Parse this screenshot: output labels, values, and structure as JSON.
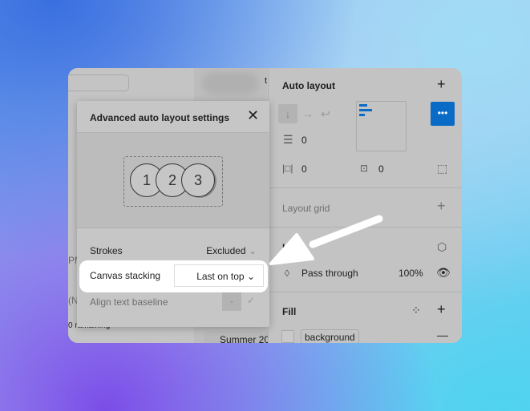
{
  "left_panel": {
    "fragments": [
      "PM",
      "(N",
      "0 ramaining",
      "Summer 20"
    ],
    "topright_char": "t"
  },
  "dialog": {
    "title": "Advanced auto layout settings",
    "preview_items": [
      "1",
      "2",
      "3"
    ],
    "rows": [
      {
        "label": "Strokes",
        "value": "Excluded"
      },
      {
        "label": "Canvas stacking",
        "value": "Last on top"
      },
      {
        "label": "Align text baseline",
        "value": "-"
      }
    ]
  },
  "right_panel": {
    "auto_layout": {
      "title": "Auto layout",
      "spacing": "0",
      "padding_h": "0",
      "padding_v": "0"
    },
    "layout_grid": {
      "title": "Layout grid"
    },
    "layer": {
      "title": "L",
      "blend": "Pass through",
      "opacity": "100%"
    },
    "fill": {
      "title": "Fill",
      "style": "background"
    }
  },
  "colors": {
    "accent": "#0a6bc7",
    "highlight": "#ffffff"
  }
}
